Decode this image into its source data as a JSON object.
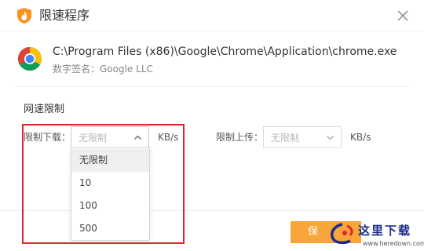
{
  "window": {
    "title": "限速程序",
    "app_icon": "shield-flame-icon",
    "close_icon": "close-icon"
  },
  "app": {
    "path": "C:\\Program Files (x86)\\Google\\Chrome\\Application\\chrome.exe",
    "signature": "数字签名：Google LLC",
    "icon": "chrome-logo-icon"
  },
  "limits": {
    "section_title": "网速限制",
    "download": {
      "label": "限制下载：",
      "value": "无限制",
      "unit": "KB/s"
    },
    "upload": {
      "label": "限制上传：",
      "value": "无限制",
      "unit": "KB/s"
    },
    "dropdown_options": [
      "无限制",
      "10",
      "100",
      "500"
    ],
    "selected_option": "无限制"
  },
  "footer": {
    "save_label": "保"
  },
  "watermark": {
    "text": "这里下载",
    "url": "www.heredown.com"
  },
  "colors": {
    "accent": "#f8a53b",
    "highlight": "#e0242a",
    "watermark": "#1d2d8c"
  }
}
